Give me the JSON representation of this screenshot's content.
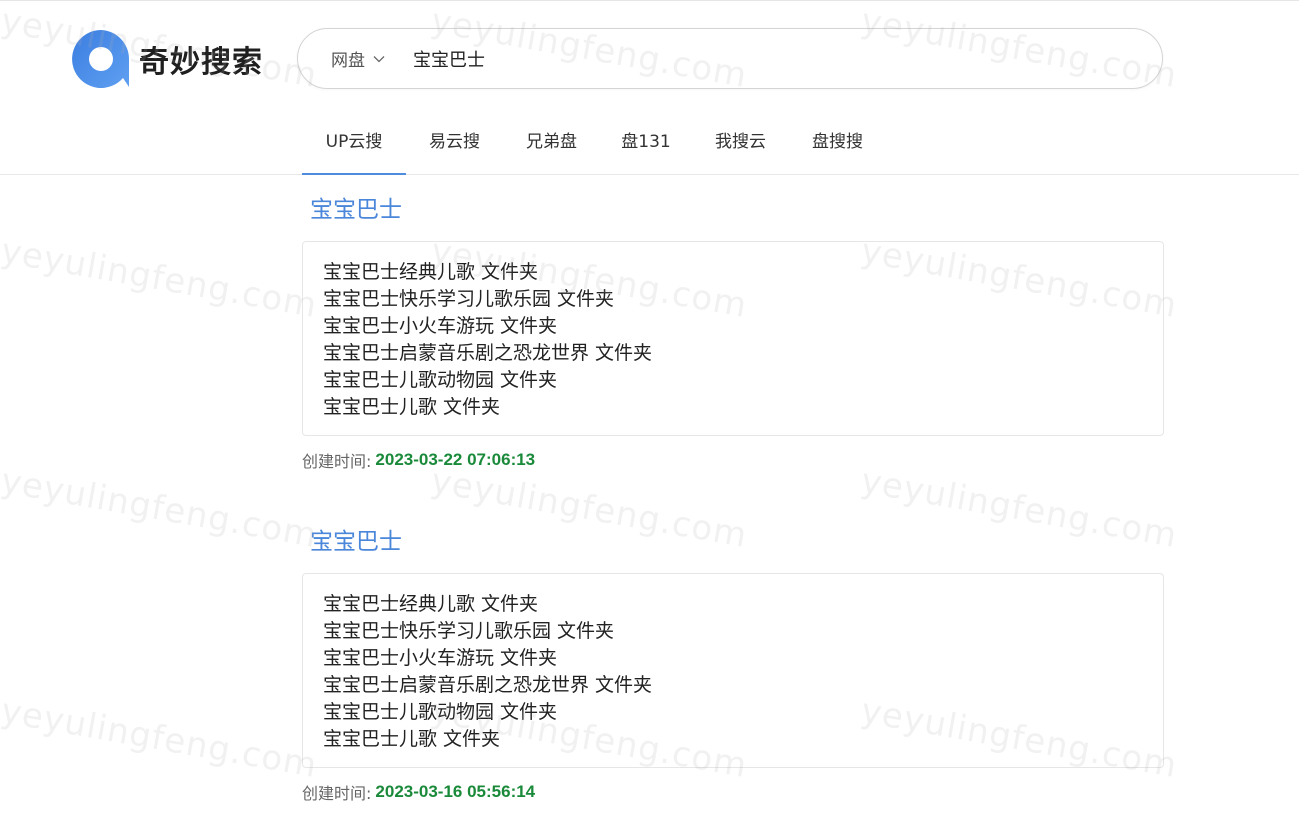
{
  "brand": {
    "name": "奇妙搜索",
    "accent_color": "#4a86da",
    "logo_icon": "search-bubble-icon"
  },
  "search": {
    "scope_label": "网盘",
    "query": "宝宝巴士"
  },
  "tabs": [
    {
      "label": "UP云搜",
      "active": true
    },
    {
      "label": "易云搜",
      "active": false
    },
    {
      "label": "兄弟盘",
      "active": false
    },
    {
      "label": "盘131",
      "active": false
    },
    {
      "label": "我搜云",
      "active": false
    },
    {
      "label": "盘搜搜",
      "active": false
    }
  ],
  "watermark": "yeyulingfeng.com",
  "results": [
    {
      "title": "宝宝巴士",
      "lines": [
        "宝宝巴士经典儿歌 文件夹",
        "宝宝巴士快乐学习儿歌乐园 文件夹",
        "宝宝巴士小火车游玩 文件夹",
        "宝宝巴士启蒙音乐剧之恐龙世界 文件夹",
        "宝宝巴士儿歌动物园 文件夹",
        "宝宝巴士儿歌 文件夹"
      ],
      "created_label": "创建时间:",
      "created_time": "2023-03-22 07:06:13"
    },
    {
      "title": "宝宝巴士",
      "lines": [
        "宝宝巴士经典儿歌 文件夹",
        "宝宝巴士快乐学习儿歌乐园 文件夹",
        "宝宝巴士小火车游玩 文件夹",
        "宝宝巴士启蒙音乐剧之恐龙世界 文件夹",
        "宝宝巴士儿歌动物园 文件夹",
        "宝宝巴士儿歌 文件夹"
      ],
      "created_label": "创建时间:",
      "created_time": "2023-03-16 05:56:14"
    }
  ]
}
